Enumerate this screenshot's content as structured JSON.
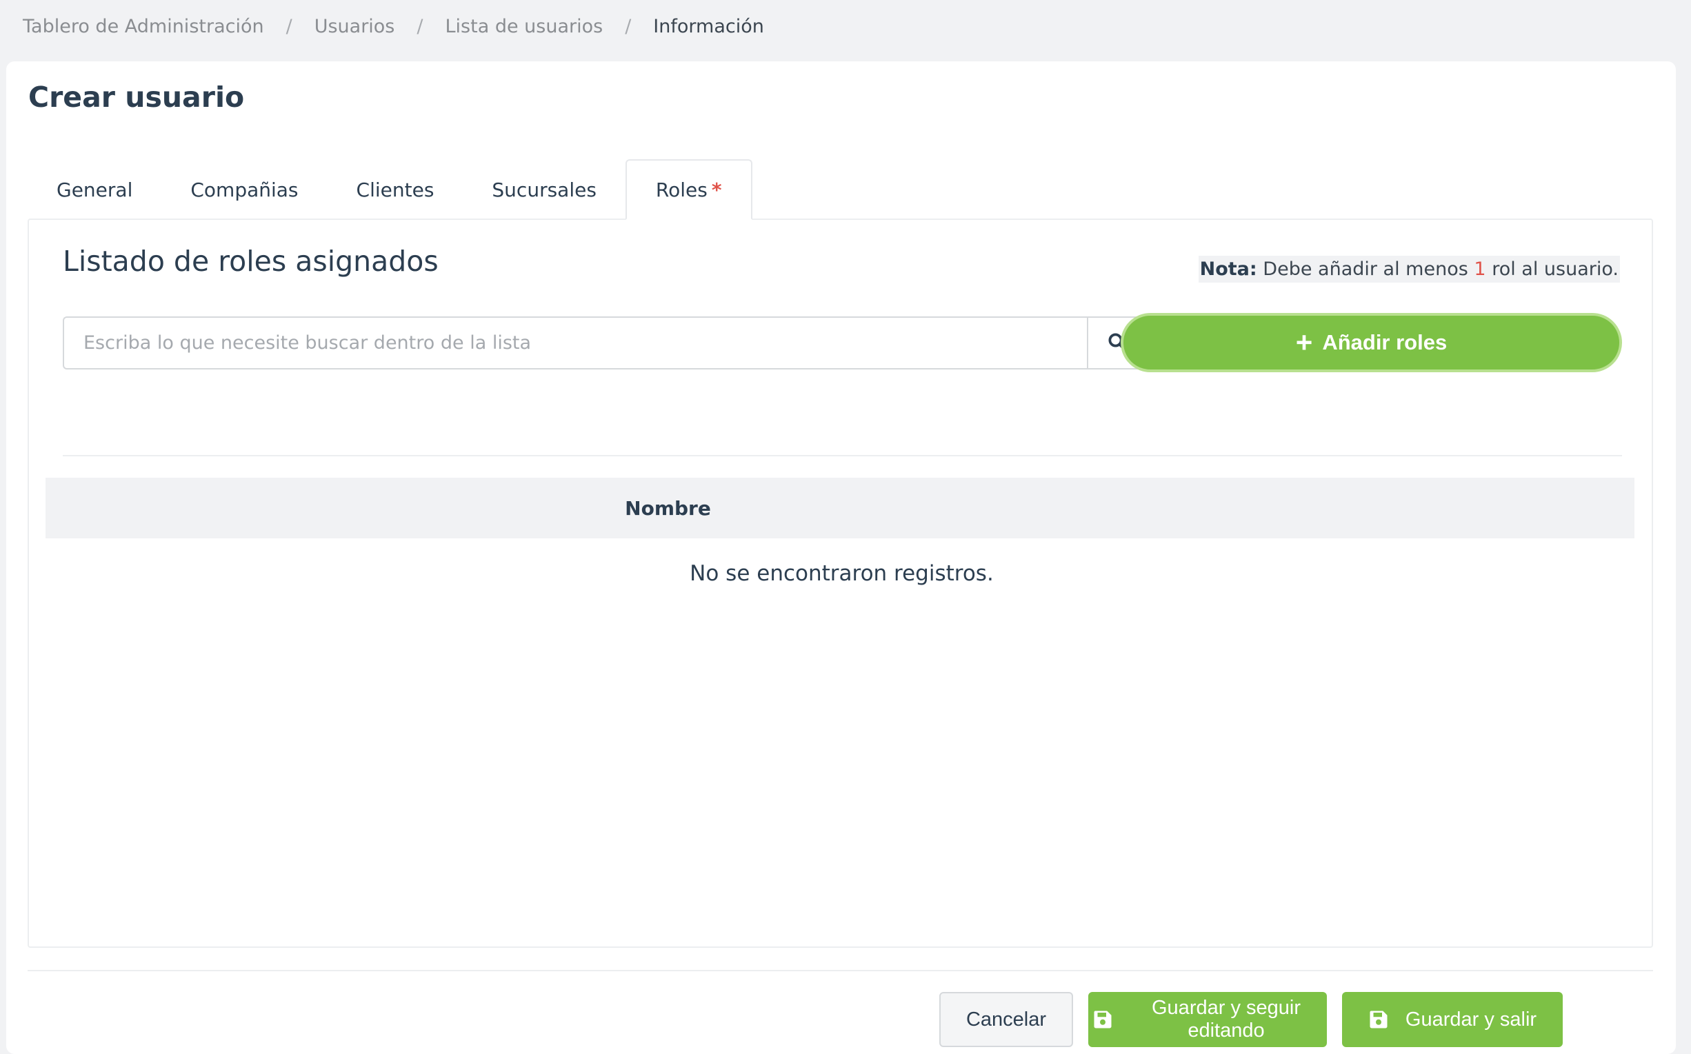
{
  "breadcrumb": {
    "items": [
      "Tablero de Administración",
      "Usuarios",
      "Lista de usuarios",
      "Información"
    ],
    "separator": "/"
  },
  "page": {
    "title": "Crear usuario"
  },
  "tabs": [
    {
      "label": "General",
      "active": false
    },
    {
      "label": "Compañias",
      "active": false
    },
    {
      "label": "Clientes",
      "active": false
    },
    {
      "label": "Sucursales",
      "active": false
    },
    {
      "label": "Roles",
      "active": true,
      "required_mark": "*"
    }
  ],
  "roles": {
    "section_title": "Listado de roles asignados",
    "note": {
      "label": "Nota:",
      "text_before": "Debe añadir al menos",
      "count": "1",
      "text_after": "rol al usuario."
    },
    "search": {
      "placeholder": "Escriba lo que necesite buscar dentro de la lista",
      "value": "",
      "icon": "search-icon"
    },
    "add_button": {
      "icon": "plus-icon",
      "label": "Añadir roles"
    },
    "table": {
      "columns": [
        "Nombre"
      ],
      "rows": [],
      "empty_message": "No se encontraron registros."
    }
  },
  "footer": {
    "cancel_label": "Cancelar",
    "save_continue_label": "Guardar y seguir editando",
    "save_exit_label": "Guardar y salir",
    "save_icon": "floppy-disk-icon"
  },
  "colors": {
    "accent_green": "#7dc145",
    "required_red": "#e0534a",
    "background": "#f1f2f4"
  }
}
